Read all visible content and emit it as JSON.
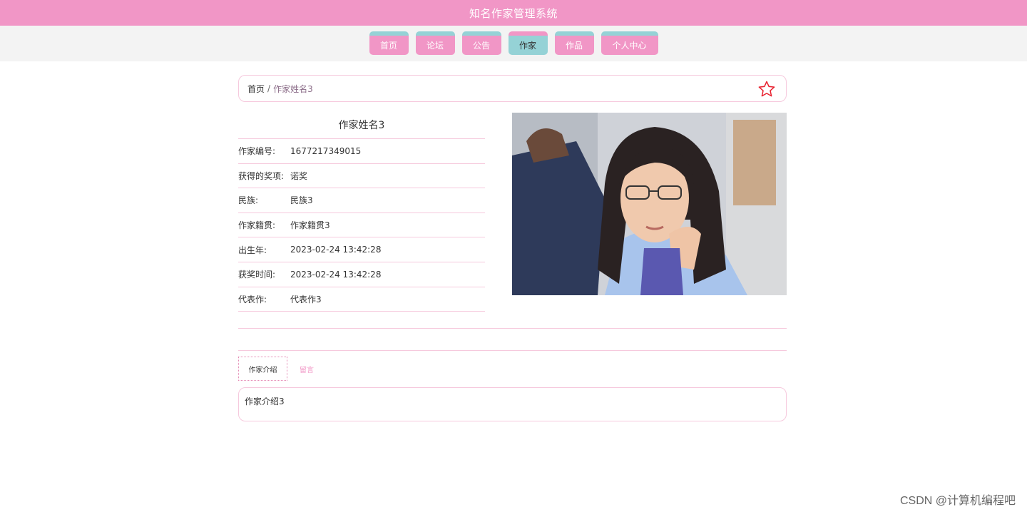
{
  "header": {
    "title": "知名作家管理系统"
  },
  "nav": {
    "items": [
      {
        "label": "首页"
      },
      {
        "label": "论坛"
      },
      {
        "label": "公告"
      },
      {
        "label": "作家"
      },
      {
        "label": "作品"
      },
      {
        "label": "个人中心"
      }
    ],
    "active_index": 3
  },
  "breadcrumb": {
    "home": "首页",
    "separator": "/",
    "current": "作家姓名3",
    "favorite_icon": "star-outline-icon"
  },
  "writer": {
    "name": "作家姓名3",
    "fields": [
      {
        "label": "作家编号:",
        "value": "1677217349015"
      },
      {
        "label": "获得的奖项:",
        "value": "诺奖"
      },
      {
        "label": "民族:",
        "value": "民族3"
      },
      {
        "label": "作家籍贯:",
        "value": "作家籍贯3"
      },
      {
        "label": "出生年:",
        "value": "2023-02-24 13:42:28"
      },
      {
        "label": "获奖时间:",
        "value": "2023-02-24 13:42:28"
      },
      {
        "label": "代表作:",
        "value": "代表作3"
      }
    ]
  },
  "tabs": {
    "intro": "作家介绍",
    "comments": "留言"
  },
  "intro_content": "作家介绍3",
  "watermark": "CSDN @计算机编程吧",
  "colors": {
    "primary_pink": "#f196c6",
    "accent_teal": "#95d2d6",
    "border_pink": "#f6c9dd",
    "star_red": "#e8212f"
  }
}
